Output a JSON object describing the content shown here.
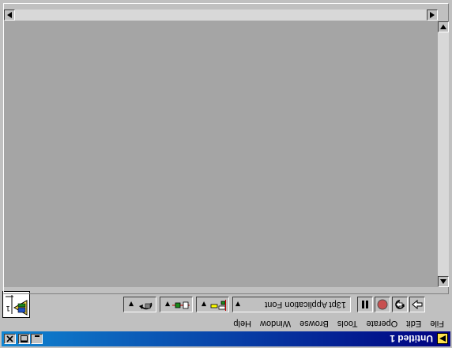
{
  "window": {
    "title": "Untitled 1",
    "controls": [
      "minimize-icon",
      "maximize-icon",
      "close-icon"
    ]
  },
  "menu": [
    "File",
    "Edit",
    "Operate",
    "Tools",
    "Browse",
    "Window",
    "Help"
  ],
  "toolbar": {
    "run_icon": "run-arrow-icon",
    "run_continuous_icon": "run-continuously-icon",
    "abort_icon": "abort-stop-icon",
    "pause_icon": "pause-icon",
    "font_selector": "13pt Application Font",
    "align_icon": "align-objects-icon",
    "distribute_icon": "distribute-objects-icon",
    "reorder_icon": "reorder-icon"
  },
  "colors": {
    "titlebar_start": "#000080",
    "titlebar_end": "#1084d0",
    "panel_background": "#a5a5a5",
    "chrome": "#c0c0c0",
    "abort_red": "#c85050"
  }
}
